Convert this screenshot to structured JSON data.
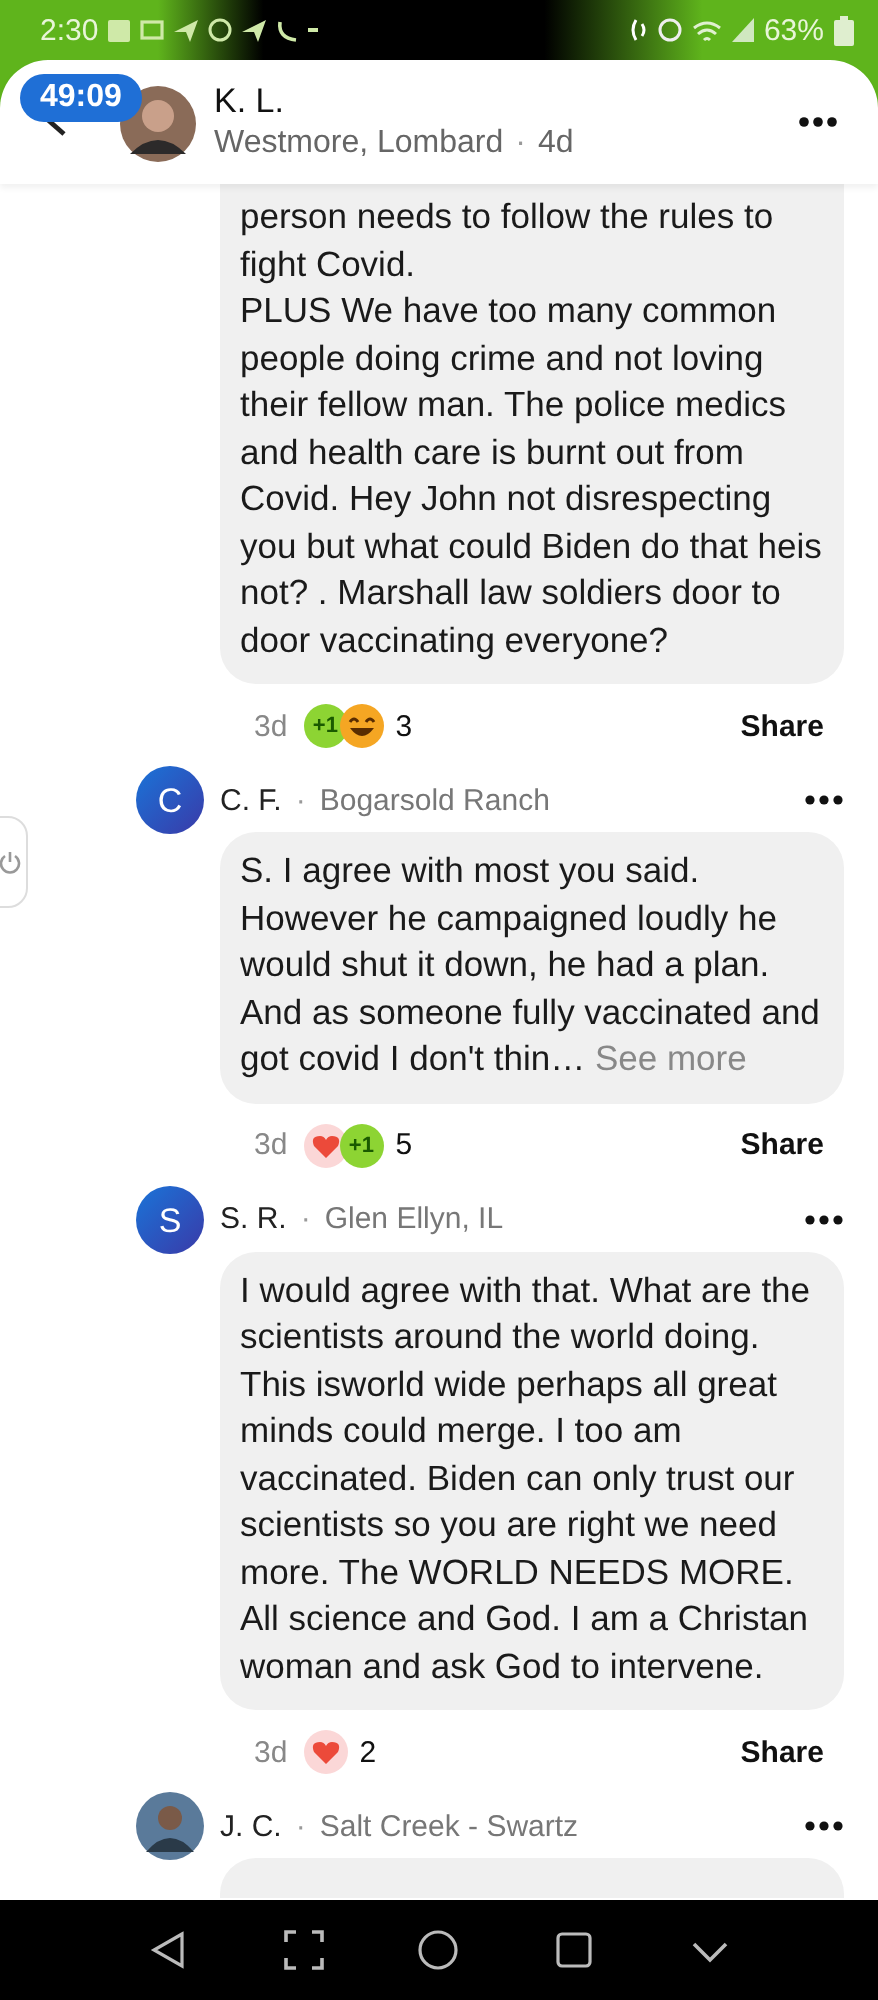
{
  "status_bar": {
    "time": "2:30",
    "battery": "63%"
  },
  "header": {
    "timer": "49:09",
    "name": "K. L.",
    "location": "Westmore, Lombard",
    "separator": "·",
    "age": "4d"
  },
  "comments": [
    {
      "text": "person needs to follow the rules to fight Covid.\nPLUS We have too many common people doing crime and not loving their fellow man. The police medics and health care is burnt out from Covid. Hey John not disrespecting you but what could Biden do that heis not? . Marshall law soldiers door to door vaccinating everyone?",
      "age": "3d",
      "reactions": [
        {
          "kind": "plus1",
          "label": "+1"
        },
        {
          "kind": "haha"
        }
      ],
      "count": "3",
      "share": "Share"
    },
    {
      "name": "C. F.",
      "separator": "·",
      "location": "Bogarsold Ranch",
      "avatar": "C",
      "text": "S. I agree with most you said. However he campaigned loudly he would shut it down, he had a plan. And as someone fully vaccinated and got covid I don't thin…",
      "see_more": "See more",
      "age": "3d",
      "reactions": [
        {
          "kind": "love"
        },
        {
          "kind": "plus1",
          "label": "+1"
        }
      ],
      "count": "5",
      "share": "Share"
    },
    {
      "name": "S. R.",
      "separator": "·",
      "location": "Glen Ellyn, IL",
      "avatar": "S",
      "text": "I would agree with that. What are the scientists around the world doing. This isworld wide perhaps all great minds could merge. I too am vaccinated. Biden can only trust our scientists so you are right we need more. The WORLD NEEDS MORE. All science and God. I am a Christan woman and ask God to intervene.",
      "age": "3d",
      "reactions": [
        {
          "kind": "love"
        }
      ],
      "count": "2",
      "share": "Share"
    },
    {
      "name": "J. C.",
      "separator": "·",
      "location": "Salt Creek - Swartz"
    }
  ]
}
